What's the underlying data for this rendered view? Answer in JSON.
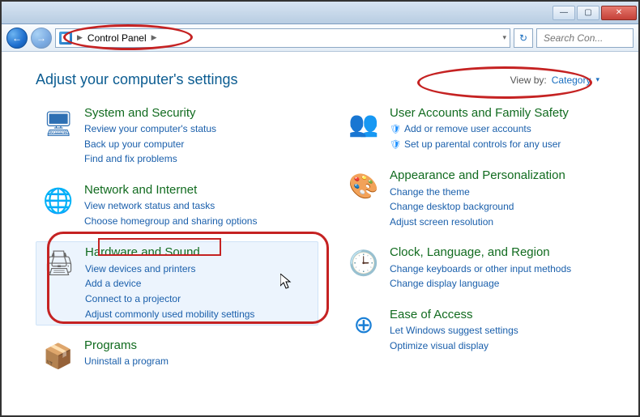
{
  "window": {
    "min": "—",
    "max": "▢",
    "close": "✕"
  },
  "nav": {
    "back_arrow": "←",
    "fwd_arrow": "→",
    "breadcrumb_sep1": "▶",
    "breadcrumb_label": "Control Panel",
    "breadcrumb_sep2": "▶",
    "addr_dropdown": "▾",
    "refresh": "↻"
  },
  "search": {
    "placeholder": "Search Con..."
  },
  "heading": "Adjust your computer's settings",
  "viewby": {
    "label": "View by:",
    "value": "Category",
    "arrow": "▾"
  },
  "left": [
    {
      "key": "system",
      "icon": "🖥",
      "title": "System and Security",
      "subs": [
        "Review your computer's status",
        "Back up your computer",
        "Find and fix problems"
      ],
      "shield": []
    },
    {
      "key": "network",
      "icon": "🌐",
      "title": "Network and Internet",
      "subs": [
        "View network status and tasks",
        "Choose homegroup and sharing options"
      ],
      "shield": []
    },
    {
      "key": "hardware",
      "icon": "🖨",
      "title": "Hardware and Sound",
      "subs": [
        "View devices and printers",
        "Add a device",
        "Connect to a projector",
        "Adjust commonly used mobility settings"
      ],
      "shield": []
    },
    {
      "key": "programs",
      "icon": "📦",
      "title": "Programs",
      "subs": [
        "Uninstall a program"
      ],
      "shield": []
    }
  ],
  "right": [
    {
      "key": "users",
      "icon": "👥",
      "title": "User Accounts and Family Safety",
      "subs": [
        "Add or remove user accounts",
        "Set up parental controls for any user"
      ],
      "shield": [
        0,
        1
      ]
    },
    {
      "key": "appearance",
      "icon": "🎨",
      "title": "Appearance and Personalization",
      "subs": [
        "Change the theme",
        "Change desktop background",
        "Adjust screen resolution"
      ],
      "shield": []
    },
    {
      "key": "clock",
      "icon": "🕒",
      "title": "Clock, Language, and Region",
      "subs": [
        "Change keyboards or other input methods",
        "Change display language"
      ],
      "shield": []
    },
    {
      "key": "ease",
      "icon": "⊕",
      "title": "Ease of Access",
      "subs": [
        "Let Windows suggest settings",
        "Optimize visual display"
      ],
      "shield": []
    }
  ]
}
